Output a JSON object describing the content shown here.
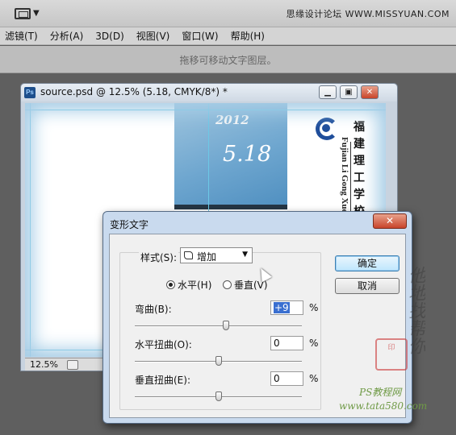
{
  "app": {
    "screen_mode_icon": "screen-mode-icon",
    "watermark": "思缘设计论坛  WWW.MISSYUAN.COM"
  },
  "menu": {
    "items": [
      "滤镜(T)",
      "分析(A)",
      "3D(D)",
      "视图(V)",
      "窗口(W)",
      "帮助(H)"
    ]
  },
  "options_bar": {
    "hint": "拖移可移动文字图层。"
  },
  "document": {
    "title": "source.psd @ 12.5% (5.18, CMYK/8*) *",
    "zoom": "12.5%",
    "canvas": {
      "year": "2012",
      "date": "5.18",
      "school_cn": "福建理工学校",
      "school_en": "Fujian Li Gong Xue"
    }
  },
  "dialog": {
    "title": "变形文字",
    "close_icon": "close-icon",
    "style_label": "样式(S):",
    "style_value": "增加",
    "orientation": {
      "horizontal": "水平(H)",
      "vertical": "垂直(V)",
      "selected": "horizontal"
    },
    "bend": {
      "label": "弯曲(B):",
      "value": "+9",
      "unit": "%",
      "slider_percent": 9
    },
    "h_distort": {
      "label": "水平扭曲(O):",
      "value": "0",
      "unit": "%",
      "slider_percent": 0
    },
    "v_distort": {
      "label": "垂直扭曲(E):",
      "value": "0",
      "unit": "%",
      "slider_percent": 0
    },
    "ok_label": "确定",
    "cancel_label": "取消"
  },
  "watermarks": {
    "handwritten": "他地找帮你",
    "seal_text": "印",
    "line1": "PS教程网",
    "line2": "www.tata580.com"
  },
  "colors": {
    "dialog_frame": "#c9daee",
    "close_red": "#c8442b",
    "selection_blue": "#3a6fd0"
  }
}
